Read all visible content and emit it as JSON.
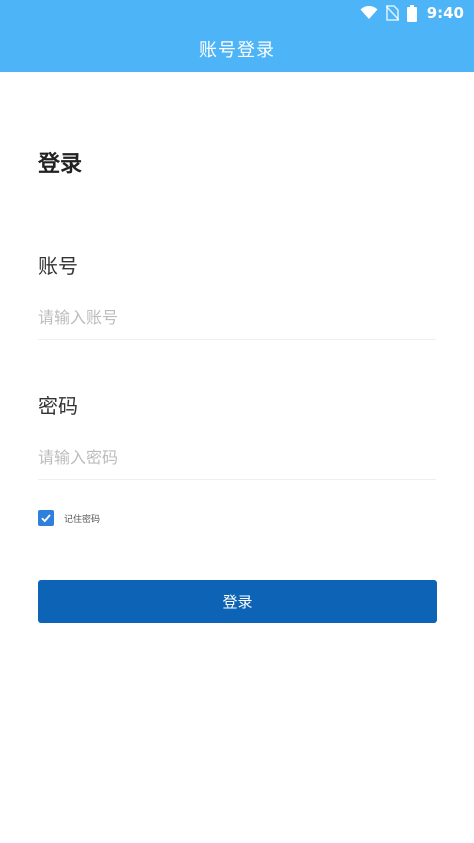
{
  "status_bar": {
    "time": "9:40",
    "icons": [
      "wifi-icon",
      "no-sim-icon",
      "battery-icon"
    ]
  },
  "header": {
    "title": "账号登录"
  },
  "form": {
    "heading": "登录",
    "account": {
      "label": "账号",
      "placeholder": "请输入账号",
      "value": ""
    },
    "password": {
      "label": "密码",
      "placeholder": "请输入密码",
      "value": ""
    },
    "remember": {
      "label": "记住密码",
      "checked": true
    },
    "submit_label": "登录"
  },
  "colors": {
    "header_bg": "#4db5f7",
    "button_bg": "#0d63b5",
    "checkbox_bg": "#2f7fdc"
  }
}
